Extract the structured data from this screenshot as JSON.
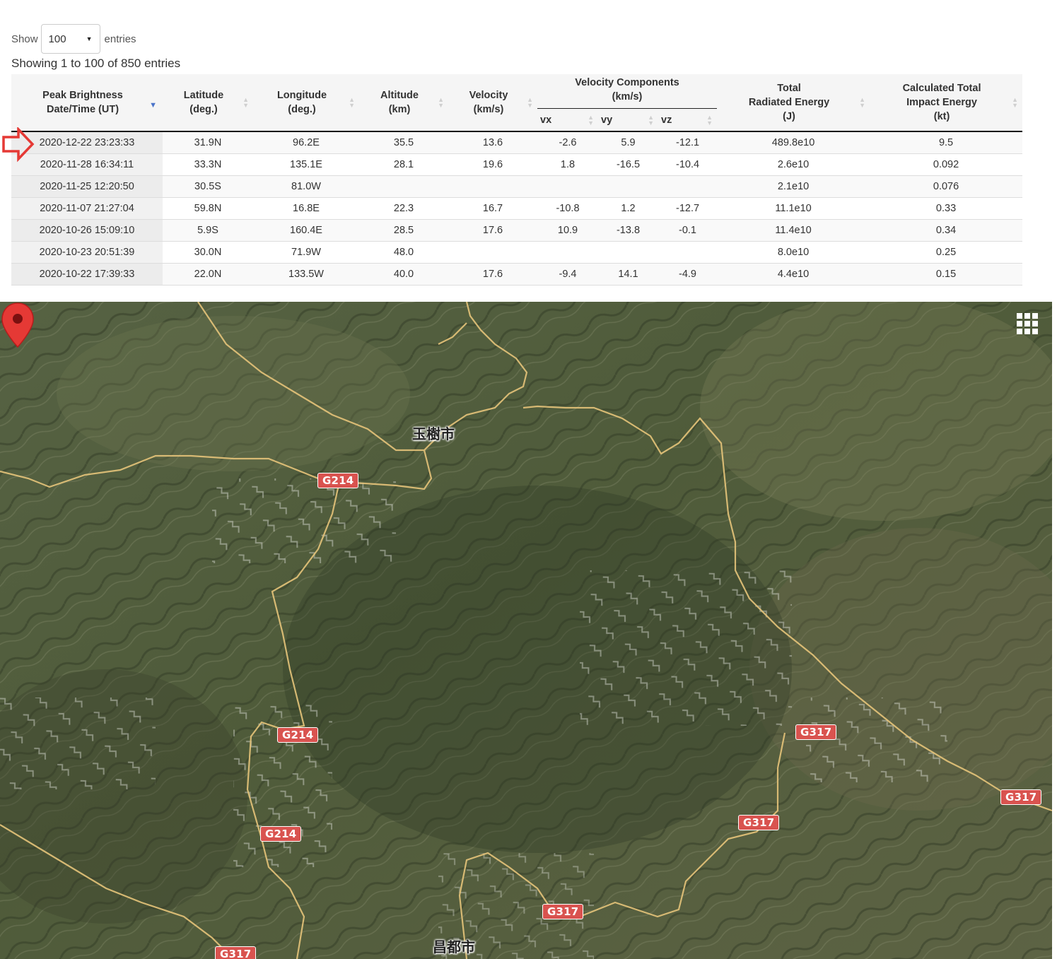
{
  "controls": {
    "show_label": "Show",
    "page_length": "100",
    "entries_label": "entries",
    "info": "Showing 1 to 100 of 850 entries"
  },
  "table": {
    "headers": {
      "date": [
        "Peak Brightness",
        "Date/Time (UT)"
      ],
      "lat": [
        "Latitude",
        "(deg.)"
      ],
      "lon": [
        "Longitude",
        "(deg.)"
      ],
      "alt": [
        "Altitude",
        "(km)"
      ],
      "vel": [
        "Velocity",
        "(km/s)"
      ],
      "vcomp": [
        "Velocity Components",
        "(km/s)"
      ],
      "vx": "vx",
      "vy": "vy",
      "vz": "vz",
      "energy": [
        "Total",
        "Radiated Energy",
        "(J)"
      ],
      "impact": [
        "Calculated Total",
        "Impact Energy",
        "(kt)"
      ]
    },
    "rows": [
      [
        "2020-12-22 23:23:33",
        "31.9N",
        "96.2E",
        "35.5",
        "13.6",
        "-2.6",
        "5.9",
        "-12.1",
        "489.8e10",
        "9.5"
      ],
      [
        "2020-11-28 16:34:11",
        "33.3N",
        "135.1E",
        "28.1",
        "19.6",
        "1.8",
        "-16.5",
        "-10.4",
        "2.6e10",
        "0.092"
      ],
      [
        "2020-11-25 12:20:50",
        "30.5S",
        "81.0W",
        "",
        "",
        "",
        "",
        "",
        "2.1e10",
        "0.076"
      ],
      [
        "2020-11-07 21:27:04",
        "59.8N",
        "16.8E",
        "22.3",
        "16.7",
        "-10.8",
        "1.2",
        "-12.7",
        "11.1e10",
        "0.33"
      ],
      [
        "2020-10-26 15:09:10",
        "5.9S",
        "160.4E",
        "28.5",
        "17.6",
        "10.9",
        "-13.8",
        "-0.1",
        "11.4e10",
        "0.34"
      ],
      [
        "2020-10-23 20:51:39",
        "30.0N",
        "71.9W",
        "48.0",
        "",
        "",
        "",
        "",
        "8.0e10",
        "0.25"
      ],
      [
        "2020-10-22 17:39:33",
        "22.0N",
        "133.5W",
        "40.0",
        "17.6",
        "-9.4",
        "14.1",
        "-4.9",
        "4.4e10",
        "0.15"
      ]
    ]
  },
  "map": {
    "cities": {
      "yushu": "玉樹市",
      "changdu": "昌都市"
    },
    "highways": {
      "g214": "G214",
      "g317": "G317"
    },
    "colors": {
      "marker": "#e53935",
      "border_line": "#e6c47a",
      "highway_badge": "#d9534f"
    }
  }
}
